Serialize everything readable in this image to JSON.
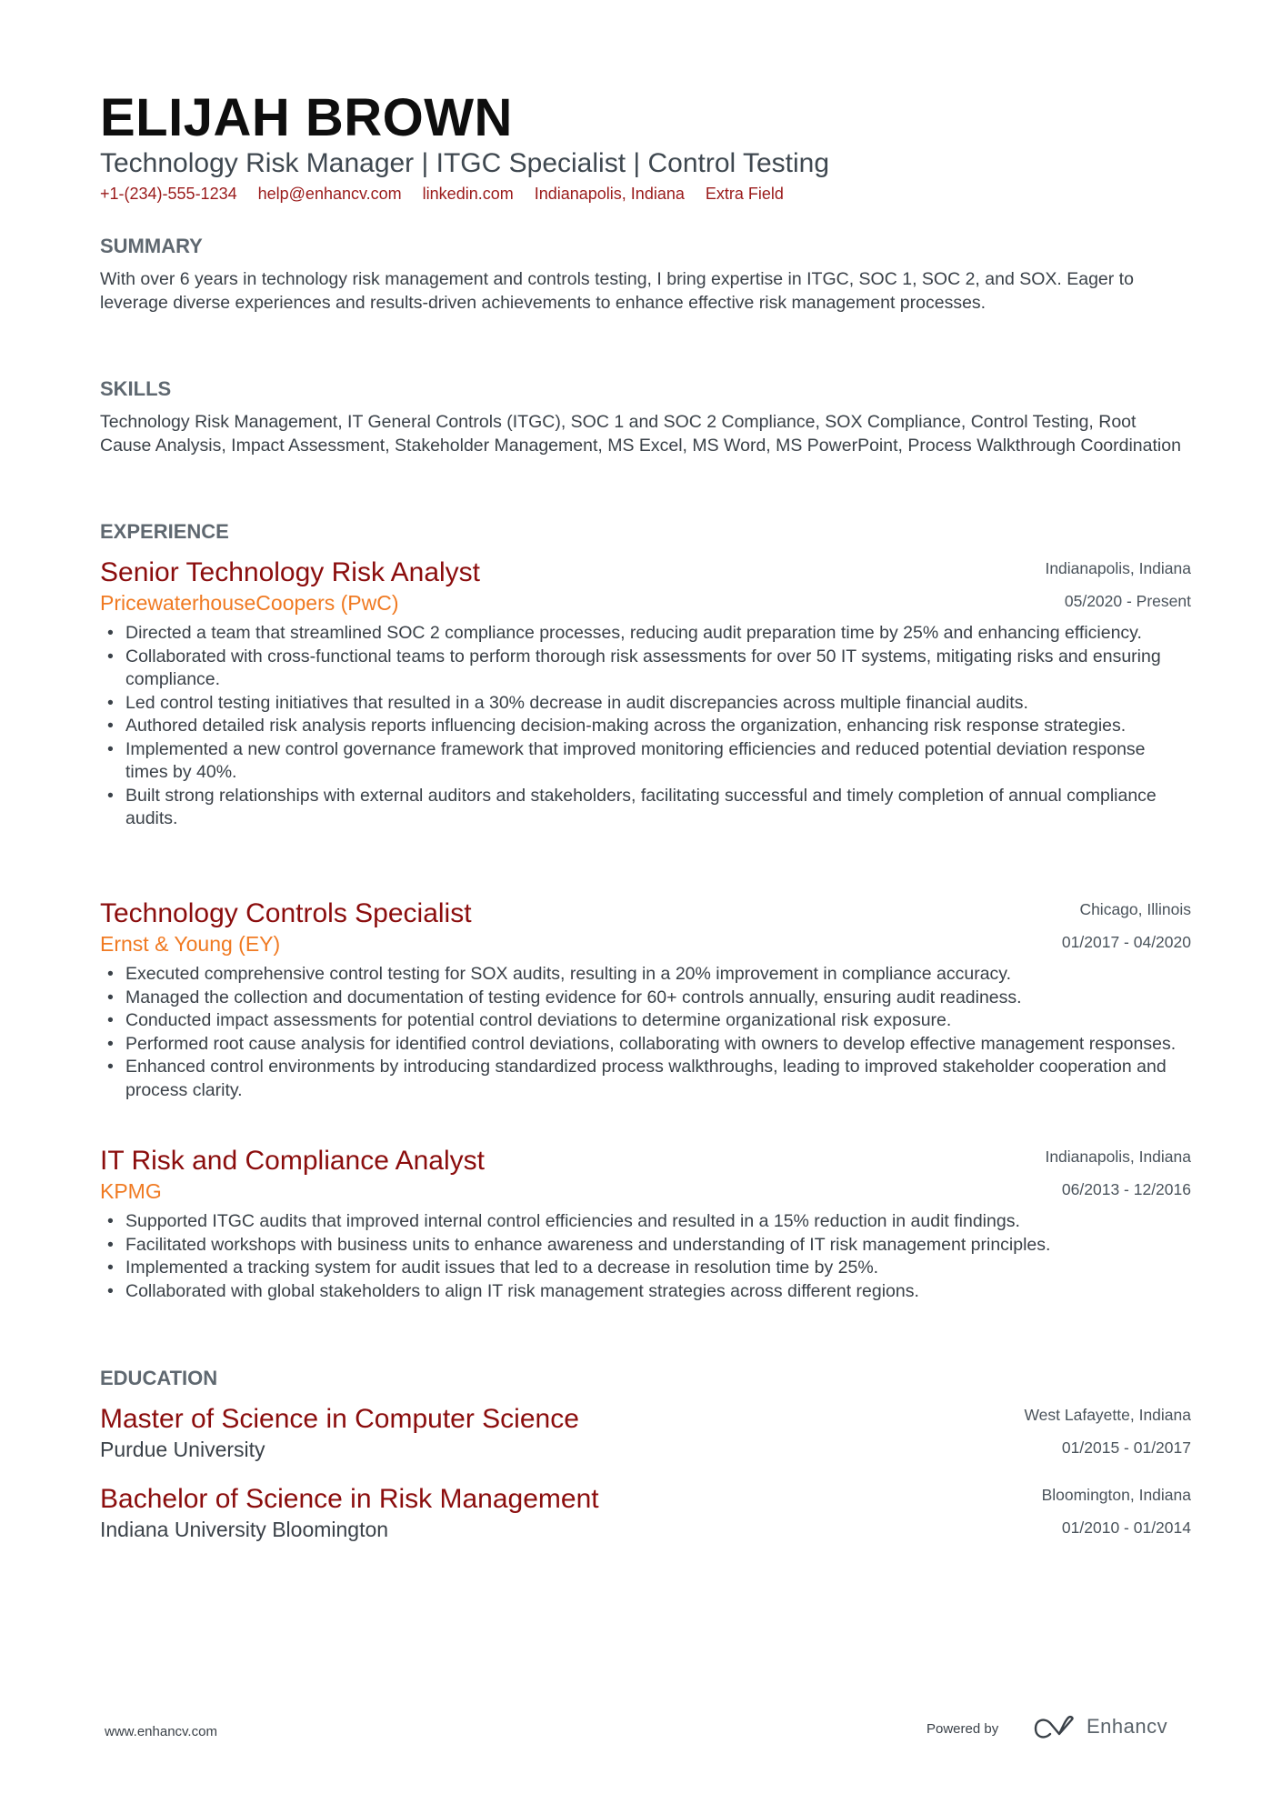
{
  "header": {
    "name": "ELIJAH BROWN",
    "headline": "Technology Risk Manager | ITGC Specialist | Control Testing",
    "contacts": [
      "+1-(234)-555-1234",
      "help@enhancv.com",
      "linkedin.com",
      "Indianapolis, Indiana",
      "Extra Field"
    ]
  },
  "summary": {
    "title": "SUMMARY",
    "text": "With over 6 years in technology risk management and controls testing, I bring expertise in ITGC, SOC 1, SOC 2, and SOX. Eager to leverage diverse experiences and results-driven achievements to enhance effective risk management processes."
  },
  "skills": {
    "title": "SKILLS",
    "text": "Technology Risk Management, IT General Controls (ITGC), SOC 1 and SOC 2 Compliance, SOX Compliance, Control Testing, Root Cause Analysis, Impact Assessment, Stakeholder Management, MS Excel, MS Word, MS PowerPoint, Process Walkthrough Coordination"
  },
  "experience": {
    "title": "EXPERIENCE",
    "items": [
      {
        "title": "Senior Technology Risk Analyst",
        "company": "PricewaterhouseCoopers (PwC)",
        "location": "Indianapolis, Indiana",
        "dates": "05/2020 - Present",
        "bullets": [
          "Directed a team that streamlined SOC 2 compliance processes, reducing audit preparation time by 25% and enhancing efficiency.",
          "Collaborated with cross-functional teams to perform thorough risk assessments for over 50 IT systems, mitigating risks and ensuring compliance.",
          "Led control testing initiatives that resulted in a 30% decrease in audit discrepancies across multiple financial audits.",
          "Authored detailed risk analysis reports influencing decision-making across the organization, enhancing risk response strategies.",
          "Implemented a new control governance framework that improved monitoring efficiencies and reduced potential deviation response times by 40%.",
          "Built strong relationships with external auditors and stakeholders, facilitating successful and timely completion of annual compliance audits."
        ]
      },
      {
        "title": "Technology Controls Specialist",
        "company": "Ernst & Young (EY)",
        "location": "Chicago, Illinois",
        "dates": "01/2017 - 04/2020",
        "bullets": [
          "Executed comprehensive control testing for SOX audits, resulting in a 20% improvement in compliance accuracy.",
          "Managed the collection and documentation of testing evidence for 60+ controls annually, ensuring audit readiness.",
          "Conducted impact assessments for potential control deviations to determine organizational risk exposure.",
          "Performed root cause analysis for identified control deviations, collaborating with owners to develop effective management responses.",
          "Enhanced control environments by introducing standardized process walkthroughs, leading to improved stakeholder cooperation and process clarity."
        ]
      },
      {
        "title": "IT Risk and Compliance Analyst",
        "company": "KPMG",
        "location": "Indianapolis, Indiana",
        "dates": "06/2013 - 12/2016",
        "bullets": [
          "Supported ITGC audits that improved internal control efficiencies and resulted in a 15% reduction in audit findings.",
          "Facilitated workshops with business units to enhance awareness and understanding of IT risk management principles.",
          "Implemented a tracking system for audit issues that led to a decrease in resolution time by 25%.",
          "Collaborated with global stakeholders to align IT risk management strategies across different regions."
        ]
      }
    ]
  },
  "education": {
    "title": "EDUCATION",
    "items": [
      {
        "degree": "Master of Science in Computer Science",
        "school": "Purdue University",
        "location": "West Lafayette, Indiana",
        "dates": "01/2015 - 01/2017"
      },
      {
        "degree": "Bachelor of Science in Risk Management",
        "school": "Indiana University Bloomington",
        "location": "Bloomington, Indiana",
        "dates": "01/2010 - 01/2014"
      }
    ]
  },
  "footer": {
    "url": "www.enhancv.com",
    "powered_by": "Powered by",
    "brand": "Enhancv",
    "logo_icon": "enhancv-logo-icon"
  },
  "colors": {
    "name": "#0e0e0e",
    "accent_title": "#8b0d0d",
    "accent_company": "#f07a22",
    "contacts": "#9a1a1a",
    "section_title": "#5f6870",
    "body_text": "#3a4148"
  }
}
